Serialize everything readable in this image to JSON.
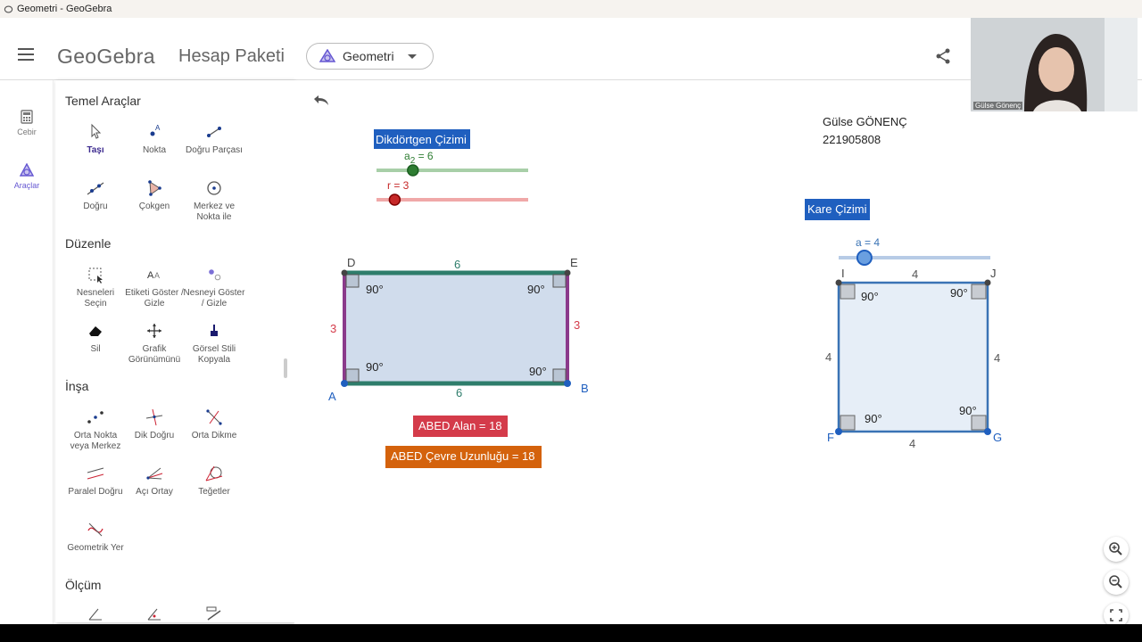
{
  "window": {
    "title": "Geometri - GeoGebra"
  },
  "header": {
    "brand": "GeoGebra",
    "product": "Hesap Paketi",
    "app_select": "Geometri"
  },
  "leftbar": {
    "items": [
      {
        "label": "Cebir",
        "icon": "calculator-icon"
      },
      {
        "label": "Araçlar",
        "icon": "tools-icon"
      }
    ]
  },
  "tools": {
    "sections": [
      {
        "title": "Temel Araçlar",
        "items": [
          "Taşı",
          "Nokta",
          "Doğru Parçası",
          "Doğru",
          "Çokgen",
          "Merkez ve Nokta ile"
        ]
      },
      {
        "title": "Düzenle",
        "items": [
          "Nesneleri Seçin",
          "Etiketi Göster / Gizle",
          "Nesneyi Göster / Gizle",
          "Sil",
          "Grafik Görünümünü",
          "Görsel Stili Kopyala"
        ]
      },
      {
        "title": "İnşa",
        "items": [
          "Orta Nokta veya Merkez",
          "Dik Doğru",
          "Orta Dikme",
          "Paralel Doğru",
          "Açı Ortay",
          "Teğetler",
          "Geometrik Yer"
        ]
      },
      {
        "title": "Ölçüm",
        "items": []
      }
    ]
  },
  "canvas": {
    "author_name": "Gülse GÖNENÇ",
    "author_id": "221905808",
    "rect": {
      "title": "Dikdörtgen Çizimi",
      "slider_a2_label": "a",
      "slider_a2_sub": "2",
      "slider_a2_value": " = 6",
      "slider_r_label": "r = 3",
      "slider_a2_fraction": 0.24,
      "slider_r_fraction": 0.12,
      "points": [
        "A",
        "B",
        "E",
        "D"
      ],
      "side_top": "6",
      "side_bottom": "6",
      "side_left": "3",
      "side_right": "3",
      "angle": "90°",
      "area_label": "ABED Alan = 18",
      "perimeter_label": "ABED Çevre Uzunluğu = 18",
      "color_fill": "#d0dcec",
      "color_long": "#2e7d6b",
      "color_short": "#8b3a8b",
      "color_area": "#d43b4a",
      "color_perimeter": "#d4620c"
    },
    "square": {
      "title": "Kare Çizimi",
      "slider_a_label": "a = 4",
      "slider_a_fraction": 0.17,
      "points": [
        "F",
        "G",
        "J",
        "I"
      ],
      "side": "4",
      "angle": "90°",
      "color_fill": "#e6eef7",
      "color_edge": "#3a73b5"
    }
  },
  "webcam": {
    "name": "Gülse Gönenç"
  },
  "colors": {
    "accent": "#1565c0",
    "geogebra_purple": "#6557d2"
  }
}
